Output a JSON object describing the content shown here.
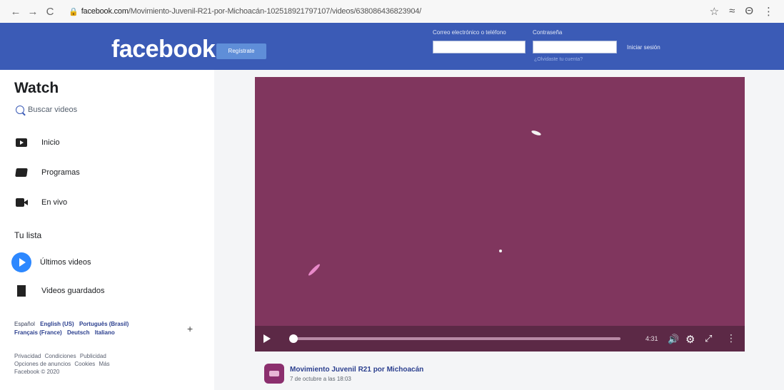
{
  "browser": {
    "back": "←",
    "forward": "→",
    "reload": "C",
    "lock": "🔒",
    "url_host": "facebook.com",
    "url_path": "/Movimiento-Juvenil-R21-por-Michoacán-102518921797107/videos/638086436823904/",
    "star": "☆",
    "reader": "≈",
    "account": "Θ",
    "more": "⋮"
  },
  "header": {
    "logo": "facebook",
    "signup": "Regístrate",
    "email_label": "Correo electrónico o teléfono",
    "password_label": "Contraseña",
    "forgot": "¿Olvidaste tu cuenta?",
    "login": "Iniciar sesión"
  },
  "sidebar": {
    "title": "Watch",
    "search_placeholder": "Buscar videos",
    "items": [
      {
        "label": "Inicio",
        "icon": "tv-icon"
      },
      {
        "label": "Programas",
        "icon": "shows-icon"
      },
      {
        "label": "En vivo",
        "icon": "live-camera-icon"
      }
    ],
    "list_title": "Tu lista",
    "list_items": [
      {
        "label": "Últimos videos",
        "icon": "play-circle-icon"
      },
      {
        "label": "Videos guardados",
        "icon": "bookmark-icon"
      }
    ],
    "languages_row1": [
      "Español",
      "English (US)",
      "Português (Brasil)"
    ],
    "languages_row2": [
      "Français (France)",
      "Deutsch",
      "Italiano"
    ],
    "plus": "+",
    "footer_row1": [
      "Privacidad",
      "Condiciones",
      "Publicidad"
    ],
    "footer_row2": [
      "Opciones de anuncios",
      "Cookies",
      "Más"
    ],
    "footer_row3": [
      "Facebook © 2020"
    ]
  },
  "video": {
    "progress": 0.0,
    "time": "4:31",
    "controls": {
      "play": "play-icon",
      "volume": "🔊",
      "settings": "⚙",
      "expand": "⤢",
      "more": "⋮"
    }
  },
  "post": {
    "page_name": "Movimiento Juvenil R21 por Michoacán",
    "date": "7 de octubre a las 18:03"
  },
  "colors": {
    "facebook_blue": "#3b5bb6",
    "video_bg": "#80365e",
    "link": "#2b3f8e"
  }
}
